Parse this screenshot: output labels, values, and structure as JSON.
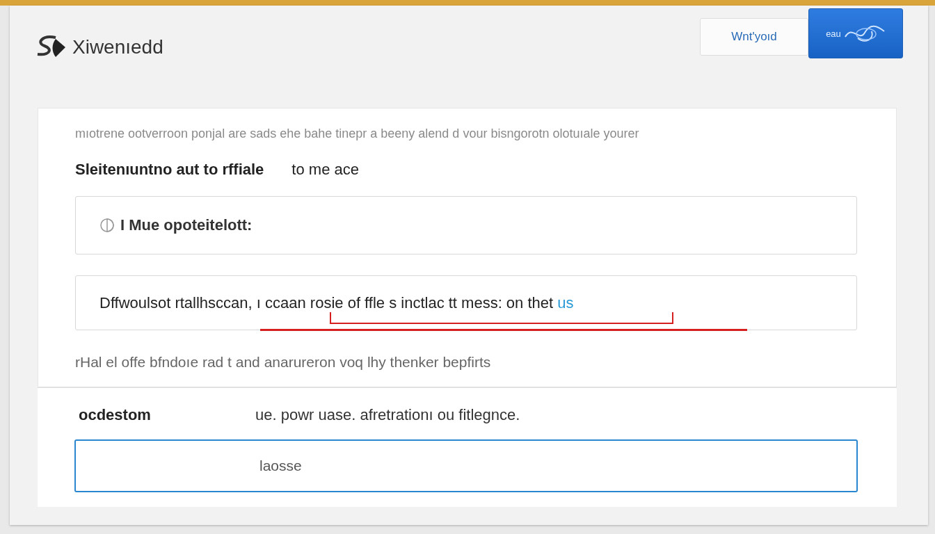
{
  "header": {
    "logo_text": "Xiwenıedd",
    "buttons": [
      {
        "label": "Wnt'yoıd",
        "kind": "outline"
      },
      {
        "label": "eau",
        "kind": "primary"
      }
    ]
  },
  "intro": "mıotrene ootverroon ponjal are sads ehe bahe tinepr a beeny alend d vour bisngorotn olotuıale yourer",
  "heading": [
    "Sleitenıuntno aut to rffiale",
    "to me ace"
  ],
  "option_box": {
    "label": "I Mue opoteitelott:"
  },
  "message_box": {
    "text": "Dffwoulsot rtallhsccan, ı ccaan rosie of ffle s inctlac tt mess: on thet",
    "link": "us"
  },
  "footnote": "rHal el offe bfndoıe rad t and anarureron voq lhy thenker bepfirts",
  "form": {
    "label": "ocdestom",
    "hint": "ue. powr uase. afretrationı ou fitlegnce.",
    "value": "laosse"
  }
}
